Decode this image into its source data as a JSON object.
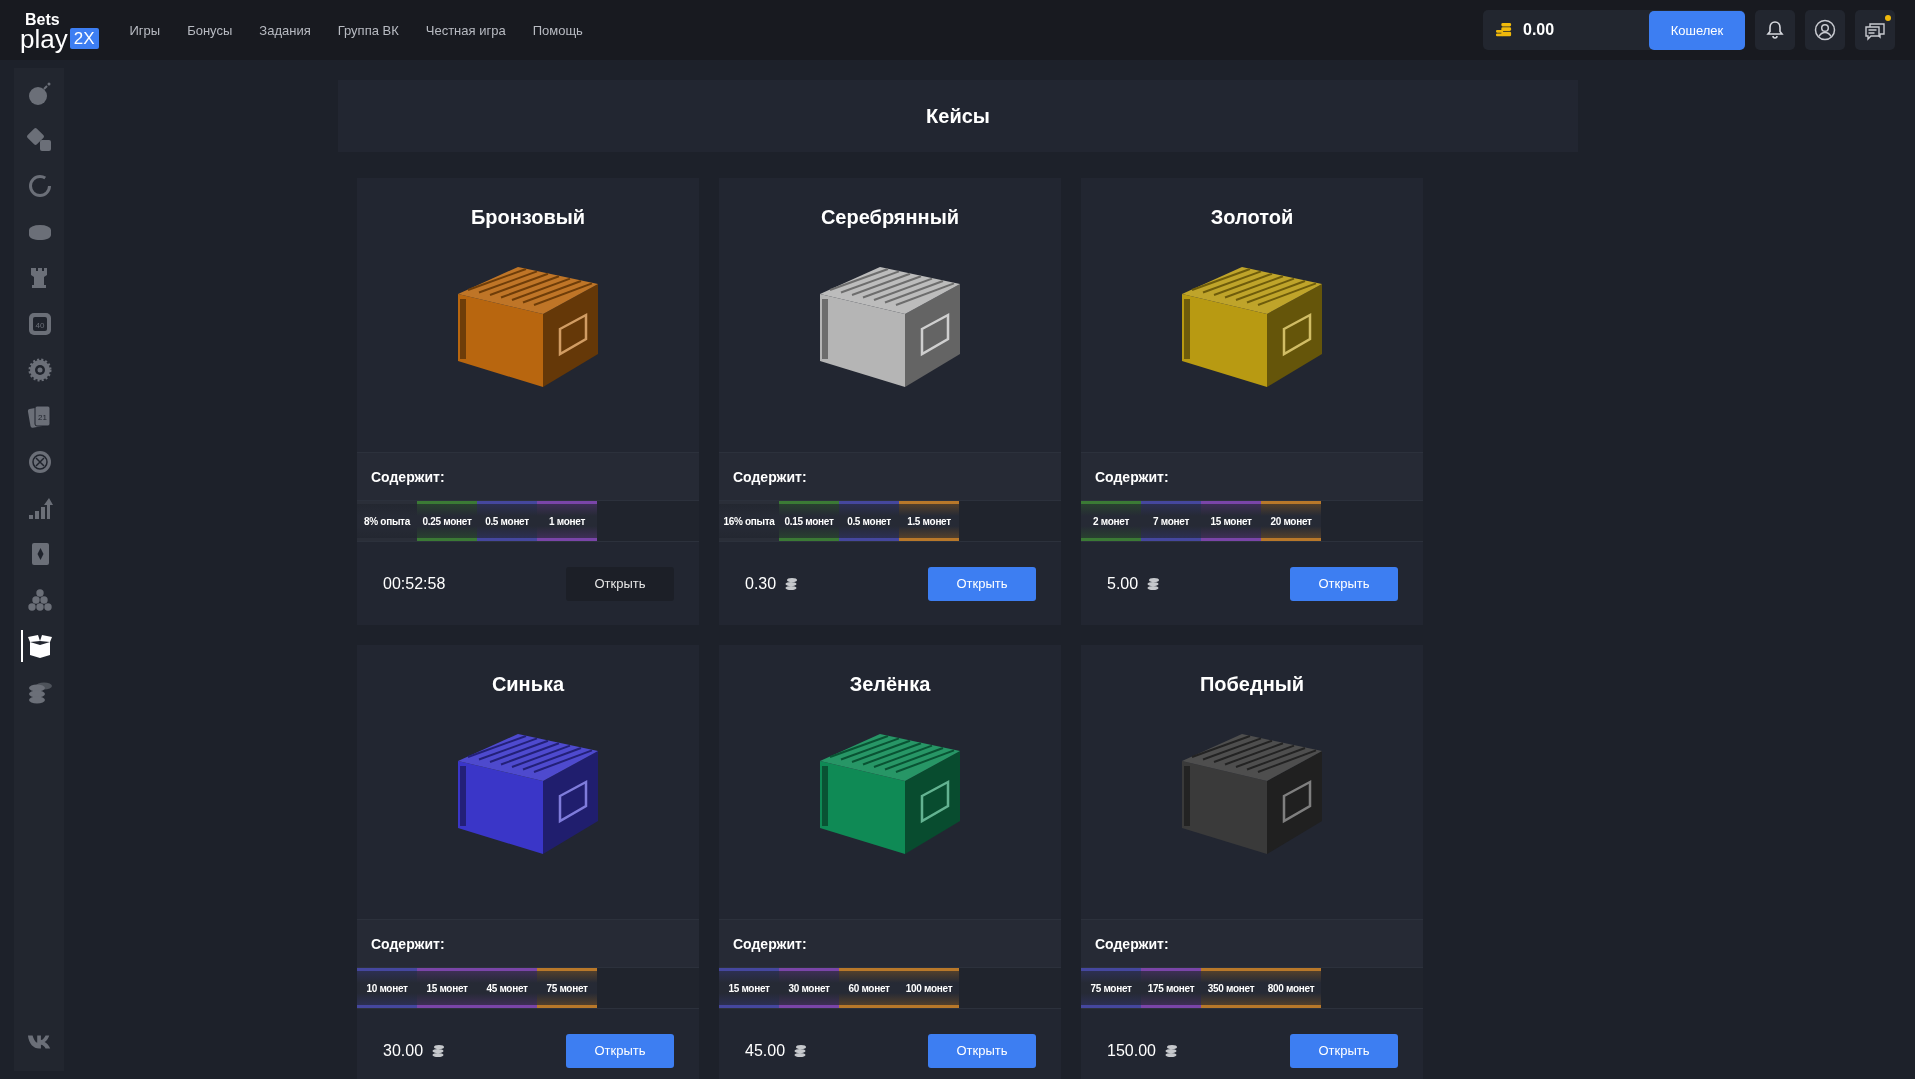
{
  "header": {
    "logo": {
      "top": "Bets",
      "main": "play",
      "badge": "2X"
    },
    "nav": [
      "Игры",
      "Бонусы",
      "Задания",
      "Группа ВК",
      "Честная игра",
      "Помощь"
    ],
    "balance": "0.00",
    "wallet_button": "Кошелек"
  },
  "sidebar": {
    "items": [
      {
        "kind": "bomb",
        "selected": false
      },
      {
        "kind": "dice",
        "selected": false
      },
      {
        "kind": "ring",
        "selected": false
      },
      {
        "kind": "coin",
        "selected": false
      },
      {
        "kind": "tower",
        "selected": false
      },
      {
        "kind": "keno",
        "selected": false,
        "label": "40"
      },
      {
        "kind": "saw",
        "selected": false
      },
      {
        "kind": "cards",
        "selected": false,
        "label": "21"
      },
      {
        "kind": "roulette",
        "selected": false
      },
      {
        "kind": "chart",
        "selected": false
      },
      {
        "kind": "card",
        "selected": false
      },
      {
        "kind": "pyramid",
        "selected": false
      },
      {
        "kind": "box",
        "selected": true
      },
      {
        "kind": "coins",
        "selected": false
      }
    ]
  },
  "page_title": "Кейсы",
  "cases": [
    {
      "title": "Бронзовый",
      "color": "#b8660f",
      "contains_label": "Содержит:",
      "items": [
        {
          "label": "8% опыта",
          "color": "#2a2e38"
        },
        {
          "label": "0.25 монет",
          "color": "#3b7a35"
        },
        {
          "label": "0.5 монет",
          "color": "#45479e"
        },
        {
          "label": "1 монет",
          "color": "#7a45a8"
        }
      ],
      "footer": {
        "kind": "timer",
        "value": "00:52:58"
      },
      "button": {
        "label": "Открыть",
        "disabled": true
      }
    },
    {
      "title": "Серебрянный",
      "color": "#b5b5b5",
      "contains_label": "Содержит:",
      "items": [
        {
          "label": "16% опыта",
          "color": "#2a2e38"
        },
        {
          "label": "0.15 монет",
          "color": "#3b7a35"
        },
        {
          "label": "0.5 монет",
          "color": "#45479e"
        },
        {
          "label": "1.5 монет",
          "color": "#b8782a"
        }
      ],
      "footer": {
        "kind": "price",
        "value": "0.30"
      },
      "button": {
        "label": "Открыть",
        "disabled": false
      }
    },
    {
      "title": "Золотой",
      "color": "#b89a12",
      "contains_label": "Содержит:",
      "items": [
        {
          "label": "2 монет",
          "color": "#3b7a35"
        },
        {
          "label": "7 монет",
          "color": "#45479e"
        },
        {
          "label": "15 монет",
          "color": "#7a45a8"
        },
        {
          "label": "20 монет",
          "color": "#b8782a"
        }
      ],
      "footer": {
        "kind": "price",
        "value": "5.00"
      },
      "button": {
        "label": "Открыть",
        "disabled": false
      }
    },
    {
      "title": "Синька",
      "color": "#3a36c8",
      "contains_label": "Содержит:",
      "items": [
        {
          "label": "10 монет",
          "color": "#45479e"
        },
        {
          "label": "15 монет",
          "color": "#7a45a8"
        },
        {
          "label": "45 монет",
          "color": "#7a45a8"
        },
        {
          "label": "75 монет",
          "color": "#b8782a"
        }
      ],
      "footer": {
        "kind": "price",
        "value": "30.00"
      },
      "button": {
        "label": "Открыть",
        "disabled": false
      }
    },
    {
      "title": "Зелёнка",
      "color": "#0f8a55",
      "contains_label": "Содержит:",
      "items": [
        {
          "label": "15 монет",
          "color": "#45479e"
        },
        {
          "label": "30 монет",
          "color": "#7a45a8"
        },
        {
          "label": "60 монет",
          "color": "#b8782a"
        },
        {
          "label": "100 монет",
          "color": "#b8782a"
        }
      ],
      "footer": {
        "kind": "price",
        "value": "45.00"
      },
      "button": {
        "label": "Открыть",
        "disabled": false
      }
    },
    {
      "title": "Победный",
      "color": "#3a3a3a",
      "contains_label": "Содержит:",
      "items": [
        {
          "label": "75 монет",
          "color": "#45479e"
        },
        {
          "label": "175 монет",
          "color": "#7a45a8"
        },
        {
          "label": "350 монет",
          "color": "#b8782a"
        },
        {
          "label": "800 монет",
          "color": "#b8782a"
        }
      ],
      "footer": {
        "kind": "price",
        "value": "150.00"
      },
      "button": {
        "label": "Открыть",
        "disabled": false
      }
    }
  ]
}
